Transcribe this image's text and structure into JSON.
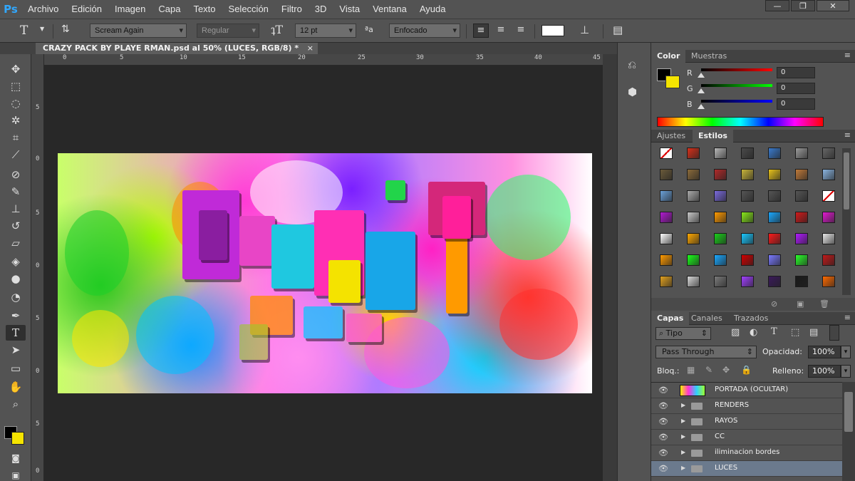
{
  "app": {
    "logo": "Ps"
  },
  "menu": [
    "Archivo",
    "Edición",
    "Imagen",
    "Capa",
    "Texto",
    "Selección",
    "Filtro",
    "3D",
    "Vista",
    "Ventana",
    "Ayuda"
  ],
  "window_controls": {
    "minimize": "—",
    "maximize": "❐",
    "close": "✕"
  },
  "options_bar": {
    "tool_icon": "T",
    "font_family": "Scream Again",
    "font_style": "Regular",
    "font_size": "12 pt",
    "aa_icon": "ªa",
    "antialias": "Enfocado",
    "text_color": "#ffffff"
  },
  "document": {
    "tab_title": "CRAZY PACK BY PLAYE RMAN.psd al 50% (LUCES, RGB/8) *",
    "close": "×"
  },
  "ruler_h": [
    "0",
    "5",
    "10",
    "15",
    "20",
    "25",
    "30",
    "35",
    "40",
    "45"
  ],
  "ruler_v": [
    "5",
    "0",
    "5",
    "0",
    "5",
    "0",
    "5",
    "0",
    "5",
    "0"
  ],
  "color_panel": {
    "tabs": [
      "Color",
      "Muestras"
    ],
    "labels": [
      "R",
      "G",
      "B"
    ],
    "values": [
      "0",
      "0",
      "0"
    ],
    "foreground": "#000000",
    "background": "#f5e400"
  },
  "styles_panel": {
    "tabs": [
      "Ajustes",
      "Estilos"
    ]
  },
  "layers_panel": {
    "tabs": [
      "Capas",
      "Canales",
      "Trazados"
    ],
    "filter": "Tipo",
    "blend_mode": "Pass Through",
    "opacity_label": "Opacidad:",
    "opacity": "100%",
    "lock_label": "Bloq.:",
    "fill_label": "Relleno:",
    "fill": "100%",
    "layers": [
      {
        "name": "PORTADA (OCULTAR)",
        "type": "image"
      },
      {
        "name": "RENDERS",
        "type": "group"
      },
      {
        "name": "RAYOS",
        "type": "group"
      },
      {
        "name": "CC",
        "type": "group"
      },
      {
        "name": "iliminacion bordes",
        "type": "group"
      },
      {
        "name": "LUCES",
        "type": "group",
        "selected": true
      }
    ]
  }
}
